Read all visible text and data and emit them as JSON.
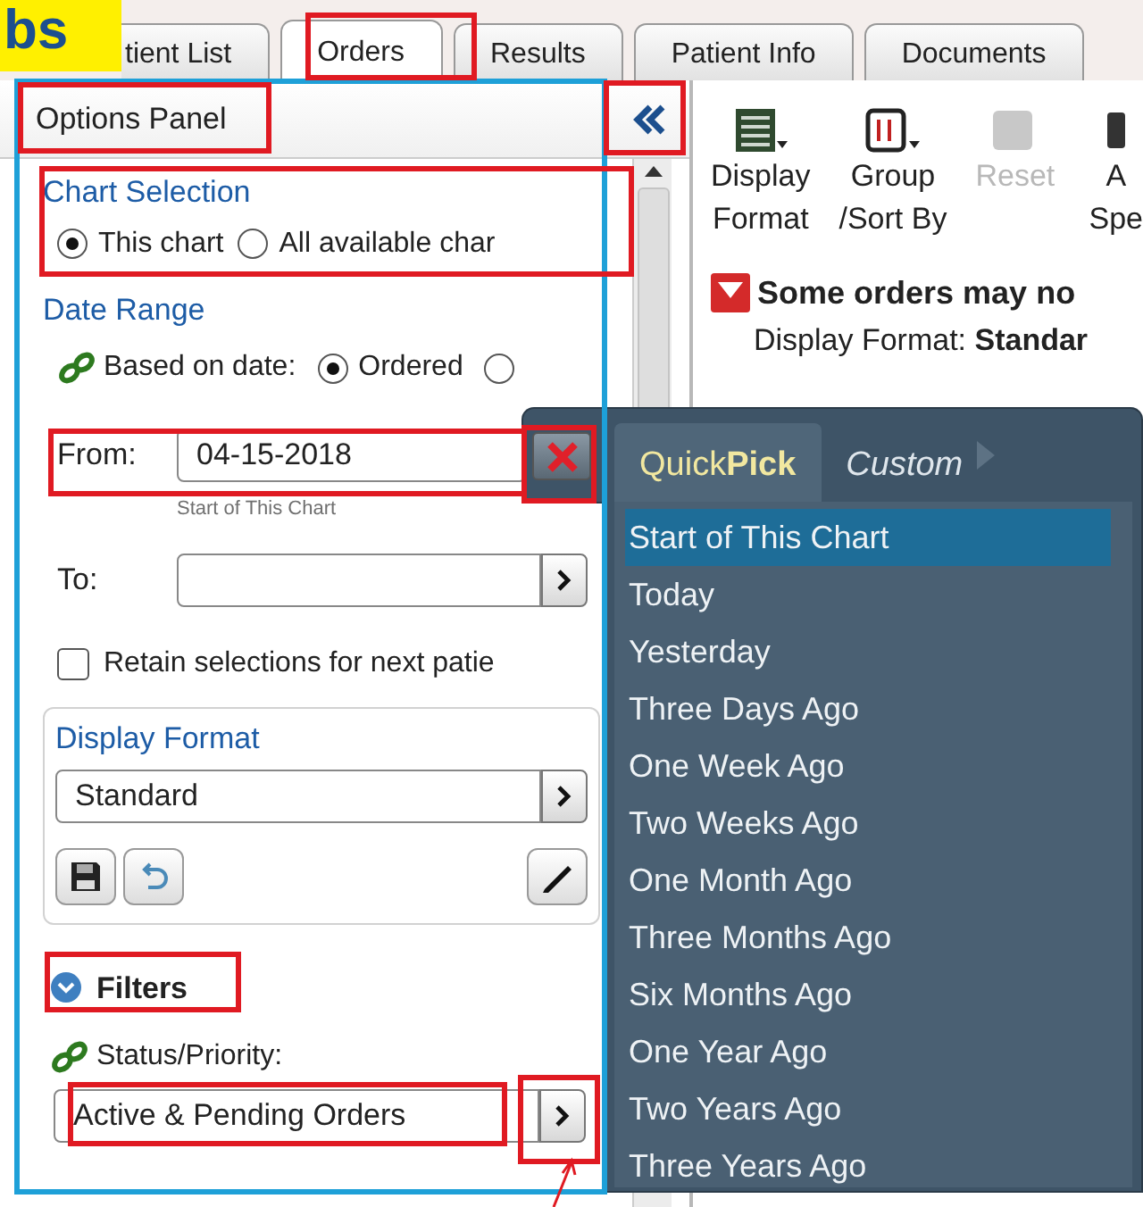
{
  "corner_label": {
    "text": "bs"
  },
  "tabs": [
    {
      "label": "tient List",
      "selected": false
    },
    {
      "label": "Orders",
      "selected": true
    },
    {
      "label": "Results",
      "selected": false
    },
    {
      "label": "Patient Info",
      "selected": false
    },
    {
      "label": "Documents",
      "selected": false
    }
  ],
  "options_panel": {
    "title": "Options Panel",
    "chart_selection": {
      "heading": "Chart Selection",
      "options": [
        {
          "label": "This chart",
          "selected": true
        },
        {
          "label": "All available char",
          "selected": false
        }
      ]
    },
    "date_range": {
      "heading": "Date Range",
      "based_on_label": "Based on date:",
      "based_on_options": [
        {
          "label": "Ordered",
          "selected": true
        },
        {
          "selected": false
        }
      ],
      "from": {
        "label": "From:",
        "value": "04-15-2018",
        "hint": "Start of This Chart"
      },
      "to": {
        "label": "To:"
      },
      "retain": {
        "label": "Retain selections for next patie",
        "checked": false
      }
    },
    "display_format": {
      "heading": "Display Format",
      "value": "Standard"
    },
    "filters": {
      "heading": "Filters",
      "expanded": true,
      "status_label": "Status/Priority:",
      "status_value": "Active & Pending Orders"
    }
  },
  "toolbar": [
    {
      "kind": "format",
      "lines": [
        "Display",
        "Format"
      ],
      "disabled": false
    },
    {
      "kind": "sort",
      "lines": [
        "Group",
        "/Sort By"
      ],
      "disabled": false
    },
    {
      "kind": "reset",
      "lines": [
        "Reset"
      ],
      "disabled": true
    },
    {
      "kind": "cut",
      "lines": [
        "A",
        "Spe"
      ],
      "disabled": false
    }
  ],
  "notice": {
    "text": "Some orders may no",
    "format_line": "Display Format: **Standar**"
  },
  "quick_pick": {
    "tabs": [
      {
        "label": "Quick**Pick**",
        "selected": true
      },
      {
        "label": "Custom",
        "selected": false
      }
    ],
    "items": [
      {
        "label": "Start of This Chart",
        "selected": true
      },
      {
        "label": "Today",
        "selected": false
      },
      {
        "label": "Yesterday",
        "selected": false
      },
      {
        "label": "Three Days Ago",
        "selected": false
      },
      {
        "label": "One Week Ago",
        "selected": false
      },
      {
        "label": "Two Weeks Ago",
        "selected": false
      },
      {
        "label": "One Month Ago",
        "selected": false
      },
      {
        "label": "Three Months Ago",
        "selected": false
      },
      {
        "label": "Six Months Ago",
        "selected": false
      },
      {
        "label": "One Year Ago",
        "selected": false
      },
      {
        "label": "Two Years Ago",
        "selected": false
      },
      {
        "label": "Three Years Ago",
        "selected": false
      }
    ]
  }
}
